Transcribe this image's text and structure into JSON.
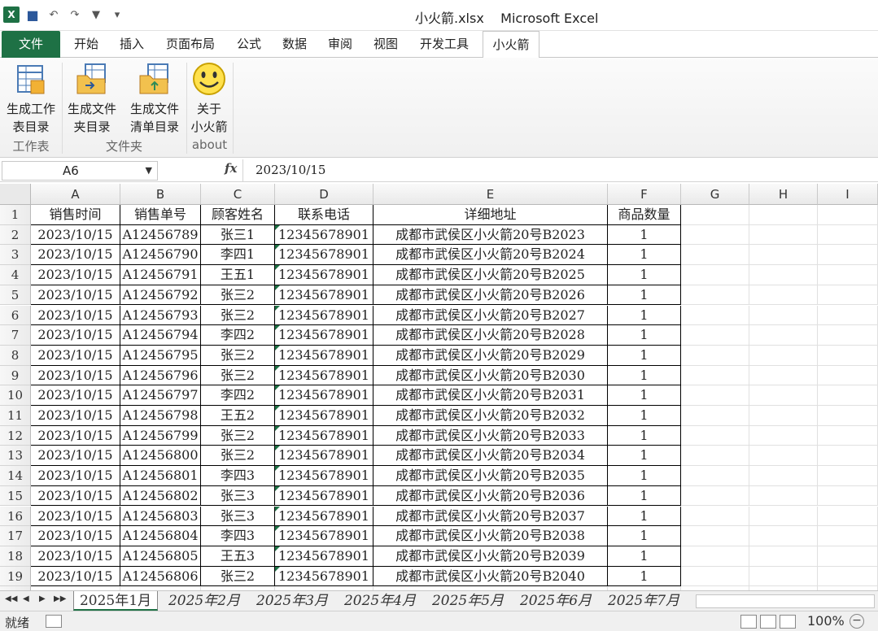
{
  "title_bar": {
    "title": "小火箭.xlsx    Microsoft Excel",
    "app_icon": "X"
  },
  "ribbon_tabs": [
    "文件",
    "开始",
    "插入",
    "页面布局",
    "公式",
    "数据",
    "审阅",
    "视图",
    "开发工具",
    "小火箭"
  ],
  "ribbon": {
    "buttons": [
      {
        "line1": "生成工作",
        "line2": "表目录",
        "icon": "sheet-list-icon"
      },
      {
        "line1": "生成文件",
        "line2": "夹目录",
        "icon": "folder-list-icon"
      },
      {
        "line1": "生成文件",
        "line2": "清单目录",
        "icon": "file-list-icon"
      },
      {
        "line1": "关于",
        "line2": "小火箭",
        "icon": "smiley-icon"
      }
    ],
    "groups": [
      "工作表",
      "文件夹",
      "about"
    ]
  },
  "formula_bar": {
    "name_box": "A6",
    "fx": "fx",
    "value": "2023/10/15"
  },
  "columns": [
    "A",
    "B",
    "C",
    "D",
    "E",
    "F",
    "G",
    "H",
    "I"
  ],
  "headers": [
    "销售时间",
    "销售单号",
    "顾客姓名",
    "联系电话",
    "详细地址",
    "商品数量"
  ],
  "rows": [
    [
      "2023/10/15",
      "A12456789",
      "张三1",
      "12345678901",
      "成都市武侯区小火箭20号B2023",
      "1"
    ],
    [
      "2023/10/15",
      "A12456790",
      "李四1",
      "12345678901",
      "成都市武侯区小火箭20号B2024",
      "1"
    ],
    [
      "2023/10/15",
      "A12456791",
      "王五1",
      "12345678901",
      "成都市武侯区小火箭20号B2025",
      "1"
    ],
    [
      "2023/10/15",
      "A12456792",
      "张三2",
      "12345678901",
      "成都市武侯区小火箭20号B2026",
      "1"
    ],
    [
      "2023/10/15",
      "A12456793",
      "张三2",
      "12345678901",
      "成都市武侯区小火箭20号B2027",
      "1"
    ],
    [
      "2023/10/15",
      "A12456794",
      "李四2",
      "12345678901",
      "成都市武侯区小火箭20号B2028",
      "1"
    ],
    [
      "2023/10/15",
      "A12456795",
      "张三2",
      "12345678901",
      "成都市武侯区小火箭20号B2029",
      "1"
    ],
    [
      "2023/10/15",
      "A12456796",
      "张三2",
      "12345678901",
      "成都市武侯区小火箭20号B2030",
      "1"
    ],
    [
      "2023/10/15",
      "A12456797",
      "李四2",
      "12345678901",
      "成都市武侯区小火箭20号B2031",
      "1"
    ],
    [
      "2023/10/15",
      "A12456798",
      "王五2",
      "12345678901",
      "成都市武侯区小火箭20号B2032",
      "1"
    ],
    [
      "2023/10/15",
      "A12456799",
      "张三2",
      "12345678901",
      "成都市武侯区小火箭20号B2033",
      "1"
    ],
    [
      "2023/10/15",
      "A12456800",
      "张三2",
      "12345678901",
      "成都市武侯区小火箭20号B2034",
      "1"
    ],
    [
      "2023/10/15",
      "A12456801",
      "李四3",
      "12345678901",
      "成都市武侯区小火箭20号B2035",
      "1"
    ],
    [
      "2023/10/15",
      "A12456802",
      "张三3",
      "12345678901",
      "成都市武侯区小火箭20号B2036",
      "1"
    ],
    [
      "2023/10/15",
      "A12456803",
      "张三3",
      "12345678901",
      "成都市武侯区小火箭20号B2037",
      "1"
    ],
    [
      "2023/10/15",
      "A12456804",
      "李四3",
      "12345678901",
      "成都市武侯区小火箭20号B2038",
      "1"
    ],
    [
      "2023/10/15",
      "A12456805",
      "王五3",
      "12345678901",
      "成都市武侯区小火箭20号B2039",
      "1"
    ],
    [
      "2023/10/15",
      "A12456806",
      "张三2",
      "12345678901",
      "成都市武侯区小火箭20号B2040",
      "1"
    ]
  ],
  "sheet_tabs": [
    "2025年1月",
    "2025年2月",
    "2025年3月",
    "2025年4月",
    "2025年5月",
    "2025年6月",
    "2025年7月"
  ],
  "status": {
    "text": "就绪",
    "zoom": "100%"
  }
}
